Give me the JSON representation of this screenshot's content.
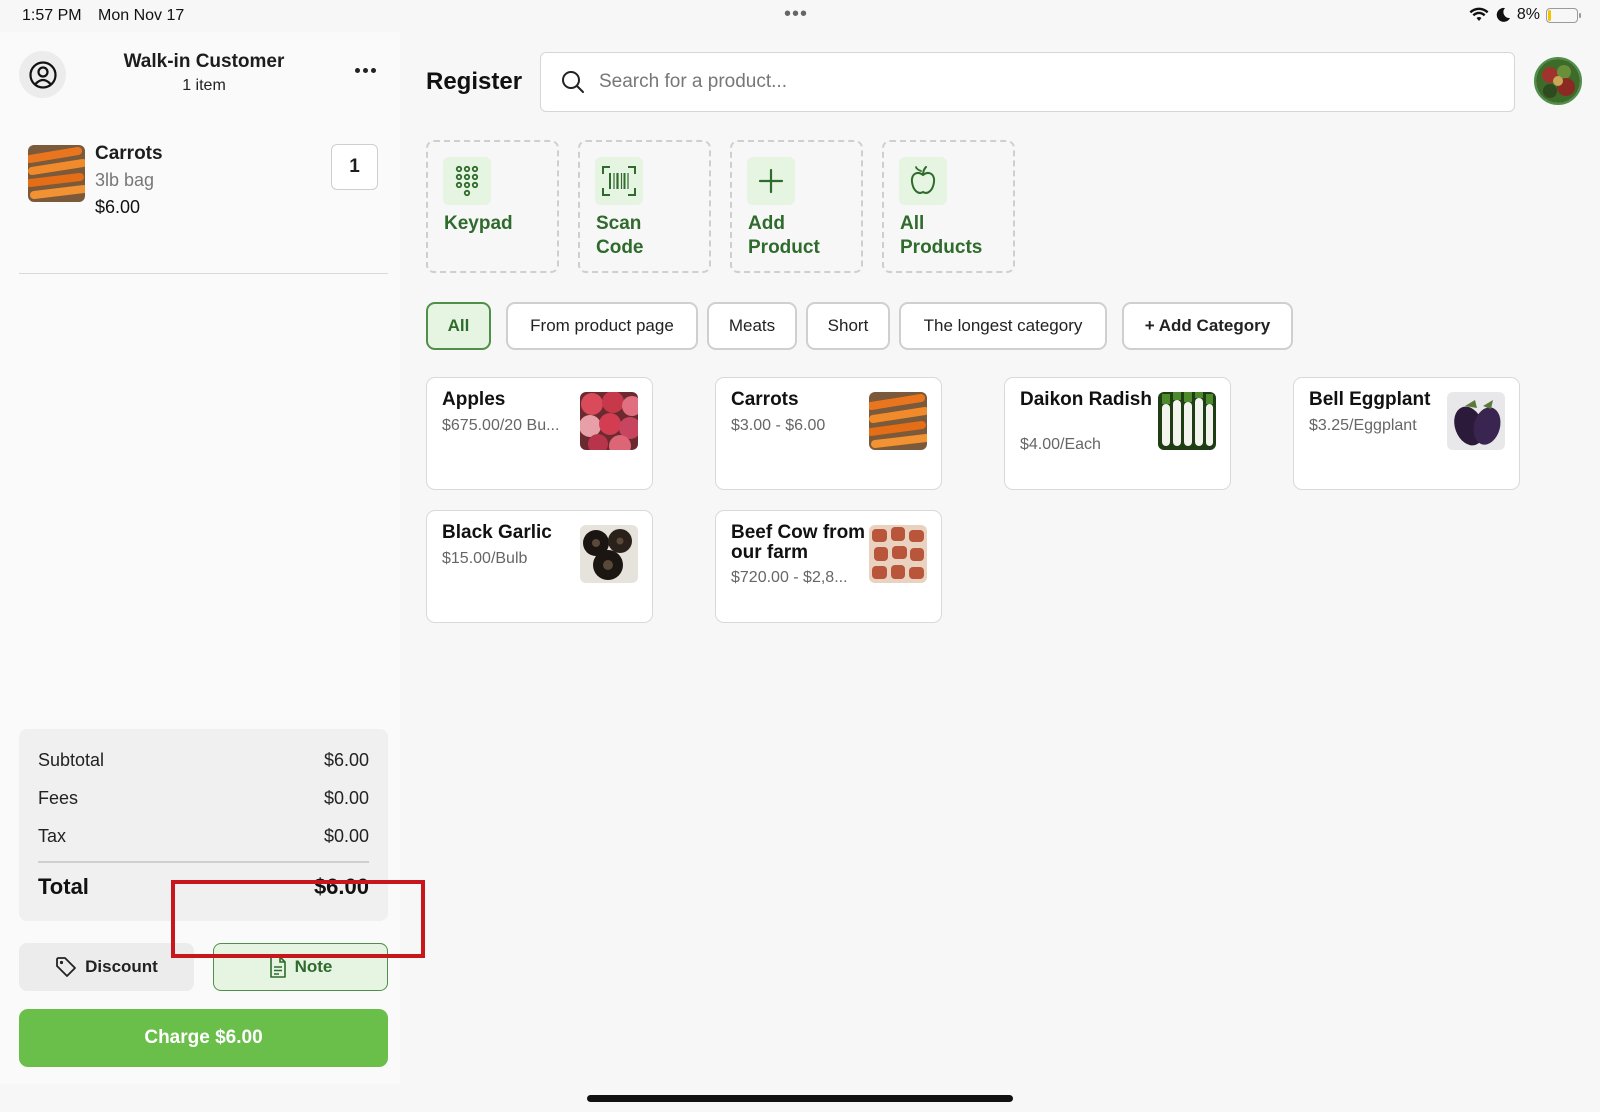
{
  "status_bar": {
    "time": "1:57 PM",
    "date": "Mon Nov 17",
    "battery": "8%",
    "battery_level": 0.08
  },
  "customer": {
    "name": "Walk-in Customer",
    "item_count": "1 item"
  },
  "cart": {
    "items": [
      {
        "name": "Carrots",
        "variant": "3lb bag",
        "price": "$6.00",
        "quantity": "1"
      }
    ]
  },
  "totals": {
    "subtotal_label": "Subtotal",
    "subtotal": "$6.00",
    "fees_label": "Fees",
    "fees": "$0.00",
    "tax_label": "Tax",
    "tax": "$0.00",
    "total_label": "Total",
    "total": "$6.00"
  },
  "actions": {
    "discount": "Discount",
    "note": "Note",
    "charge": "Charge $6.00"
  },
  "header": {
    "title": "Register",
    "search_placeholder": "Search for a product..."
  },
  "quick_actions": [
    {
      "line1": "Keypad",
      "line2": ""
    },
    {
      "line1": "Scan",
      "line2": "Code"
    },
    {
      "line1": "Add",
      "line2": "Product"
    },
    {
      "line1": "All",
      "line2": "Products"
    }
  ],
  "categories": [
    "All",
    "From product page",
    "Meats",
    "Short",
    "The longest category",
    "+ Add Category"
  ],
  "products": [
    {
      "name": "Apples",
      "price": "$675.00/20 Bu..."
    },
    {
      "name": "Carrots",
      "price": "$3.00 - $6.00"
    },
    {
      "name": "Daikon Radish",
      "price": "$4.00/Each"
    },
    {
      "name": "Bell Eggplant",
      "price": "$3.25/Eggplant"
    },
    {
      "name": "Black Garlic",
      "price": "$15.00/Bulb"
    },
    {
      "name": "Beef Cow from our farm",
      "price": "$720.00 - $2,8..."
    }
  ],
  "colors": {
    "accent": "#4f8f4a",
    "charge": "#6abf4b",
    "highlight": "#c8161d"
  }
}
